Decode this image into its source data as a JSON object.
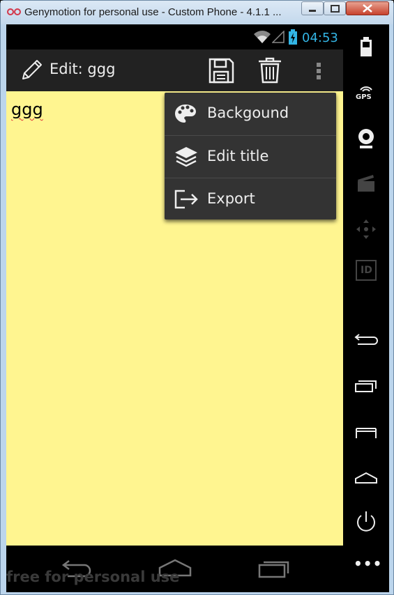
{
  "window": {
    "title": "Genymotion for personal use - Custom Phone - 4.1.1 ..."
  },
  "status_bar": {
    "clock": "04:53"
  },
  "action_bar": {
    "title": "Edit: ggg",
    "icons": [
      "pencil-icon",
      "save-icon",
      "trash-icon",
      "overflow-menu-icon"
    ]
  },
  "note": {
    "text": "ggg"
  },
  "overflow_menu": {
    "items": [
      {
        "label": "Backgound",
        "icon": "palette-icon"
      },
      {
        "label": "Edit title",
        "icon": "layers-icon"
      },
      {
        "label": "Export",
        "icon": "export-icon"
      }
    ]
  },
  "nav_bar": {
    "watermark": "free for personal use"
  },
  "side_panel": {
    "gps_label": "GPS",
    "id_label": "ID",
    "more_label": "•••"
  },
  "colors": {
    "note_background": "#fff590",
    "action_bar": "#222222",
    "menu": "#333333",
    "clock": "#33b5e5"
  }
}
